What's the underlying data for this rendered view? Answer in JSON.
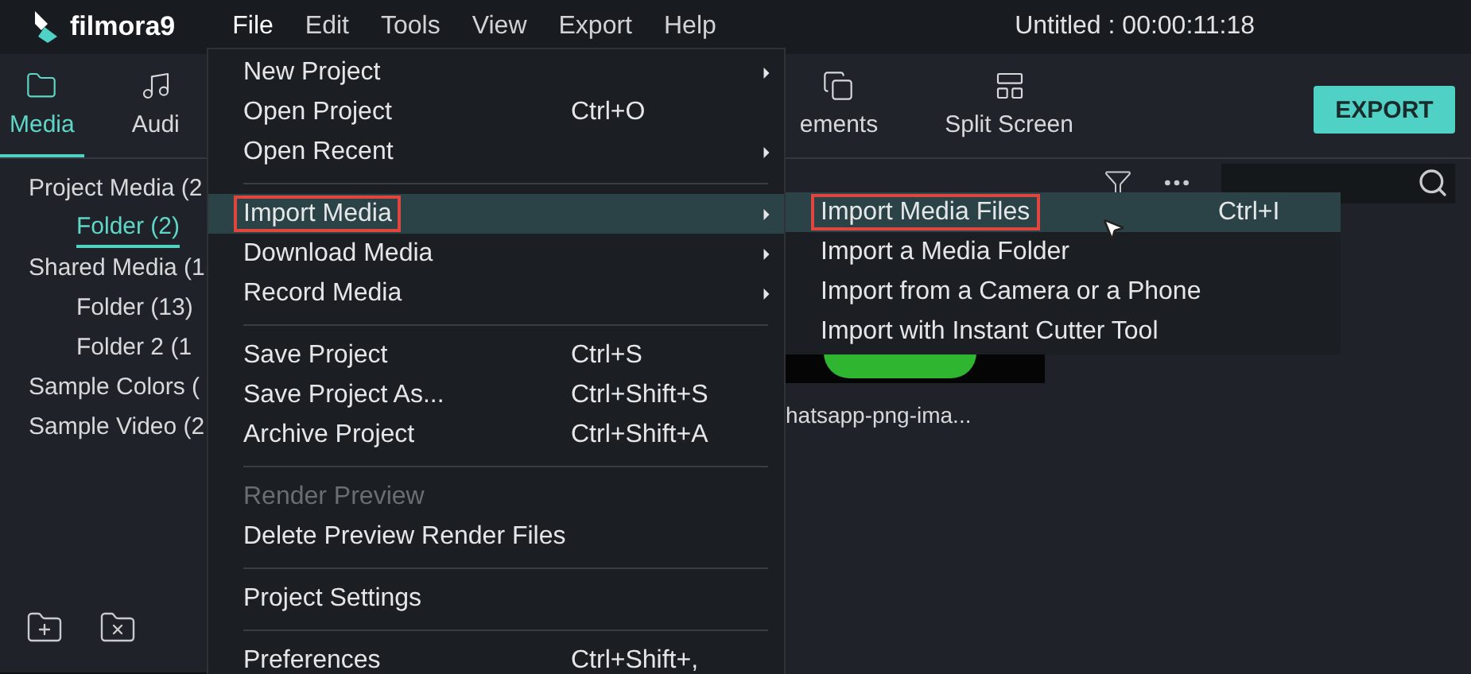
{
  "app": {
    "logo": "filmora9",
    "title": "Untitled : 00:00:11:18"
  },
  "menubar": [
    {
      "label": "File",
      "selected": true
    },
    {
      "label": "Edit",
      "selected": false
    },
    {
      "label": "Tools",
      "selected": false
    },
    {
      "label": "View",
      "selected": false
    },
    {
      "label": "Export",
      "selected": false
    },
    {
      "label": "Help",
      "selected": false
    }
  ],
  "tabs": [
    {
      "label": "Media",
      "selected": true
    },
    {
      "label": "Audi",
      "selected": false
    },
    {
      "label": "ements",
      "selected": false
    },
    {
      "label": "Split Screen",
      "selected": false
    }
  ],
  "export_button": "EXPORT",
  "sidebar": {
    "items": [
      {
        "label": "Project Media (2",
        "selected": false,
        "children": [
          {
            "label": "Folder (2)",
            "selected": true
          }
        ]
      },
      {
        "label": "Shared Media (1",
        "selected": false,
        "children": [
          {
            "label": "Folder (13)",
            "selected": false
          },
          {
            "label": "Folder 2 (1",
            "selected": false
          }
        ]
      },
      {
        "label": "Sample Colors (",
        "selected": false
      },
      {
        "label": "Sample Video (2",
        "selected": false
      }
    ]
  },
  "media": [
    {
      "kind": "picture",
      "label": "hatsapp-png-ima..."
    }
  ],
  "file_menu": [
    {
      "kind": "item",
      "label": "New Project",
      "submenu": true,
      "selected": false,
      "disabled": false,
      "marked": false
    },
    {
      "kind": "item",
      "label": "Open Project",
      "shortcut": "Ctrl+O",
      "submenu": false,
      "selected": false,
      "disabled": false,
      "marked": false
    },
    {
      "kind": "item",
      "label": "Open Recent",
      "submenu": true,
      "selected": false,
      "disabled": false,
      "marked": false
    },
    {
      "kind": "separator"
    },
    {
      "kind": "item",
      "label": "Import Media",
      "submenu": true,
      "selected": true,
      "disabled": false,
      "marked": true
    },
    {
      "kind": "item",
      "label": "Download Media",
      "submenu": true,
      "selected": false,
      "disabled": false,
      "marked": false
    },
    {
      "kind": "item",
      "label": "Record Media",
      "submenu": true,
      "selected": false,
      "disabled": false,
      "marked": false
    },
    {
      "kind": "separator"
    },
    {
      "kind": "item",
      "label": "Save Project",
      "shortcut": "Ctrl+S",
      "submenu": false,
      "selected": false,
      "disabled": false,
      "marked": false
    },
    {
      "kind": "item",
      "label": "Save Project As...",
      "shortcut": "Ctrl+Shift+S",
      "submenu": false,
      "selected": false,
      "disabled": false,
      "marked": false
    },
    {
      "kind": "item",
      "label": "Archive Project",
      "shortcut": "Ctrl+Shift+A",
      "submenu": false,
      "selected": false,
      "disabled": false,
      "marked": false
    },
    {
      "kind": "separator"
    },
    {
      "kind": "item",
      "label": "Render Preview",
      "submenu": false,
      "selected": false,
      "disabled": true,
      "marked": false
    },
    {
      "kind": "item",
      "label": "Delete Preview Render Files",
      "submenu": false,
      "selected": false,
      "disabled": false,
      "marked": false
    },
    {
      "kind": "separator"
    },
    {
      "kind": "item",
      "label": "Project Settings",
      "submenu": false,
      "selected": false,
      "disabled": false,
      "marked": false
    },
    {
      "kind": "separator"
    },
    {
      "kind": "item",
      "label": "Preferences",
      "shortcut": "Ctrl+Shift+,",
      "submenu": false,
      "selected": false,
      "disabled": false,
      "marked": false
    }
  ],
  "import_submenu": [
    {
      "label": "Import Media Files",
      "shortcut": "Ctrl+I",
      "selected": true,
      "marked": true
    },
    {
      "label": "Import a Media Folder",
      "selected": false,
      "marked": false
    },
    {
      "label": "Import from a Camera or a Phone",
      "selected": false,
      "marked": false
    },
    {
      "label": "Import with Instant Cutter Tool",
      "selected": false,
      "marked": false
    }
  ]
}
